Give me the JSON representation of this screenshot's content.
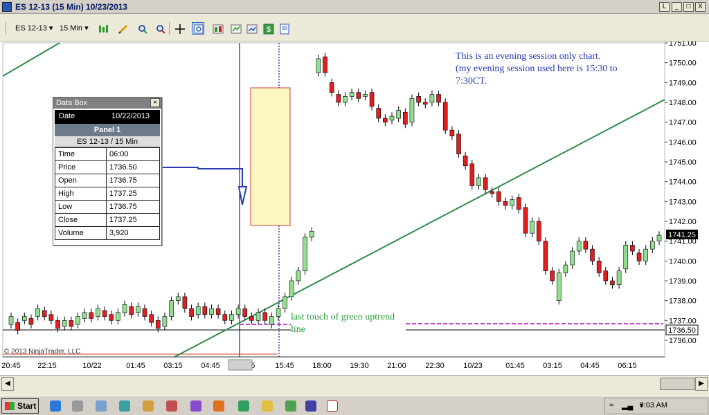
{
  "window": {
    "title": "ES 12-13 (15 Min)  10/23/2013",
    "controls": [
      "L",
      "_",
      "□",
      "X"
    ]
  },
  "toolbar": {
    "instrument": "ES 12-13",
    "interval": "15 Min"
  },
  "databox": {
    "title": "Data Box",
    "date_label": "Date",
    "date_value": "10/22/2013",
    "panel": "Panel 1",
    "instrument": "ES 12-13 / 15 Min",
    "rows": [
      {
        "k": "Time",
        "v": "06:00"
      },
      {
        "k": "Price",
        "v": "1736.50"
      },
      {
        "k": "Open",
        "v": "1736.75"
      },
      {
        "k": "High",
        "v": "1737.25"
      },
      {
        "k": "Low",
        "v": "1736.75"
      },
      {
        "k": "Close",
        "v": "1737.25"
      },
      {
        "k": "Volume",
        "v": "3,920"
      }
    ]
  },
  "annotations": {
    "note_line1": "This is an evening session only chart.",
    "note_line2": "(my evening session used here is 15:30 to",
    "note_line3": "7:30CT.",
    "trend_note1": "last touch of green uptrend",
    "trend_note2": "line",
    "copyright": "© 2013 NinjaTrader, LLC"
  },
  "chart_data": {
    "type": "candlestick",
    "y_ticks": [
      "1751.00",
      "1750.00",
      "1749.00",
      "1748.00",
      "1747.00",
      "1746.00",
      "1745.00",
      "1744.00",
      "1743.00",
      "1742.00",
      "1741.00",
      "1740.00",
      "1739.00",
      "1738.00",
      "1737.00",
      "1736.00"
    ],
    "x_ticks": [
      "20:45",
      "22:15",
      "10/22",
      "01:45",
      "03:15",
      "04:45",
      "06:00 5",
      "15:45",
      "18:00",
      "19:30",
      "21:00",
      "22:30",
      "10/23",
      "01:45",
      "03:15",
      "04:45",
      "06:15"
    ],
    "last_price_label": "1741.25",
    "crosshair_price_label": "1736.50",
    "ylim": [
      1735.5,
      1751.2
    ]
  },
  "taskbar": {
    "start": "Start",
    "clock": "9:03 AM"
  }
}
